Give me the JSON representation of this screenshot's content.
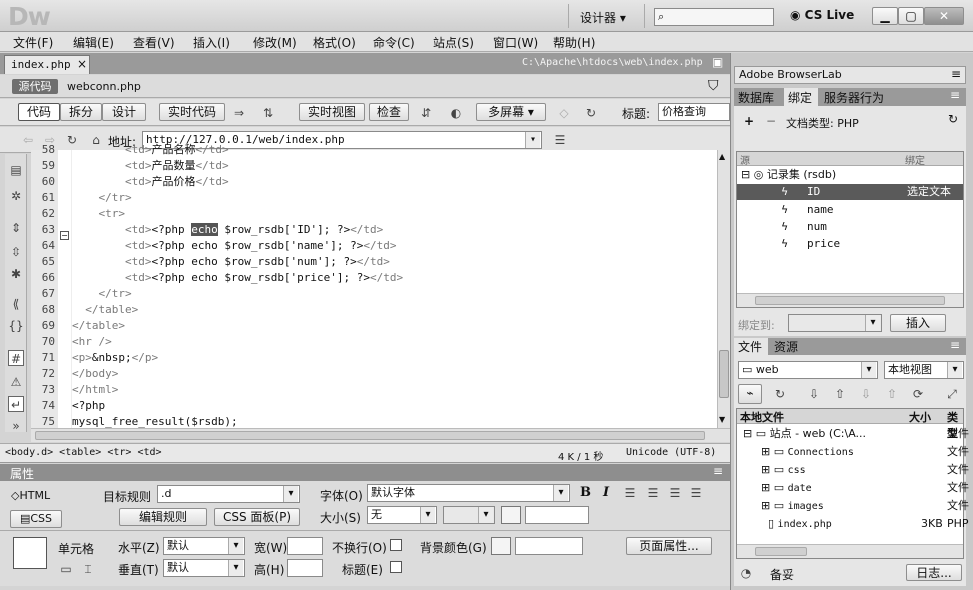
{
  "app": {
    "logo": "Dw",
    "workspace": "设计器",
    "product": "CS Live",
    "search_placeholder": ""
  },
  "menu": [
    "文件(F)",
    "编辑(E)",
    "查看(V)",
    "插入(I)",
    "修改(M)",
    "格式(O)",
    "命令(C)",
    "站点(S)",
    "窗口(W)",
    "帮助(H)"
  ],
  "doc": {
    "tab": "index.php",
    "close": "×",
    "path": "C:\\Apache\\htdocs\\web\\index.php",
    "source_btn": "源代码",
    "related_file": "webconn.php"
  },
  "toolbar": {
    "code": "代码",
    "split": "拆分",
    "design": "设计",
    "live_code": "实时代码",
    "live_view": "实时视图",
    "inspect": "检查",
    "multiscreen": "多屏幕",
    "title_label": "标题:",
    "title_value": "价格查询"
  },
  "address": {
    "label": "地址:",
    "url": "http://127.0.0.1/web/index.php"
  },
  "code": {
    "lines": [
      {
        "n": "58",
        "t": "        <td>产品名称</td>",
        "cut": true
      },
      {
        "n": "59",
        "t": "        <td>产品数量</td>"
      },
      {
        "n": "60",
        "t": "        <td>产品价格</td>"
      },
      {
        "n": "61",
        "t": "    </tr>"
      },
      {
        "n": "62",
        "t": "    <tr>"
      },
      {
        "n": "63",
        "t": "        <td><?php echo $row_rsdb['ID']; ?></td>",
        "hl": true
      },
      {
        "n": "64",
        "t": "        <td><?php echo $row_rsdb['name']; ?></td>"
      },
      {
        "n": "65",
        "t": "        <td><?php echo $row_rsdb['num']; ?></td>"
      },
      {
        "n": "66",
        "t": "        <td><?php echo $row_rsdb['price']; ?></td>"
      },
      {
        "n": "67",
        "t": "    </tr>"
      },
      {
        "n": "68",
        "t": "  </table>"
      },
      {
        "n": "69",
        "t": "</table>"
      },
      {
        "n": "70",
        "t": "<hr />"
      },
      {
        "n": "71",
        "t": "<p>&nbsp;</p>"
      },
      {
        "n": "72",
        "t": "</body>"
      },
      {
        "n": "73",
        "t": "</html>"
      },
      {
        "n": "74",
        "t": "<?php"
      },
      {
        "n": "75",
        "t": "mysql_free_result($rsdb);"
      },
      {
        "n": "76",
        "t": "?>"
      }
    ]
  },
  "status": {
    "breadcrumb": "<body.d> <table> <tr> <td>",
    "size": "4 K / 1 秒",
    "encoding": "Unicode (UTF-8)"
  },
  "props": {
    "title": "属性",
    "html": "HTML",
    "css": "CSS",
    "target_rule_label": "目标规则",
    "target_rule_value": ".d",
    "edit_rule": "编辑规则",
    "css_panel": "CSS 面板(P)",
    "font_label": "字体(O)",
    "font_value": "默认字体",
    "size_label": "大小(S)",
    "size_value": "无",
    "cell": "单元格",
    "horz_label": "水平(Z)",
    "horz_value": "默认",
    "vert_label": "垂直(T)",
    "vert_value": "默认",
    "width_label": "宽(W)",
    "height_label": "高(H)",
    "nowrap_label": "不换行(O)",
    "header_label": "标题(E)",
    "bg_label": "背景颜色(G)",
    "page_props": "页面属性..."
  },
  "browserlab": {
    "title": "Adobe BrowserLab"
  },
  "bindings": {
    "tabs": [
      "数据库",
      "绑定",
      "服务器行为"
    ],
    "doc_type": "文档类型: PHP",
    "col_source": "源",
    "col_binding": "绑定",
    "recordset": "记录集 (rsdb)",
    "fields": [
      "ID",
      "name",
      "num",
      "price"
    ],
    "selected_text": "选定文本",
    "bind_to": "绑定到:",
    "insert": "插入"
  },
  "files": {
    "tabs": [
      "文件",
      "资源"
    ],
    "site": "web",
    "view": "本地视图",
    "col_local": "本地文件",
    "col_size": "大小",
    "col_type": "类型",
    "root": "站点 - web (C:\\A...",
    "root_type": "文件",
    "items": [
      {
        "name": "Connections",
        "size": "",
        "type": "文件"
      },
      {
        "name": "css",
        "size": "",
        "type": "文件"
      },
      {
        "name": "date",
        "size": "",
        "type": "文件"
      },
      {
        "name": "images",
        "size": "",
        "type": "文件"
      },
      {
        "name": "index.php",
        "size": "3KB",
        "type": "PHP"
      }
    ],
    "status": "备妥",
    "log": "日志..."
  }
}
